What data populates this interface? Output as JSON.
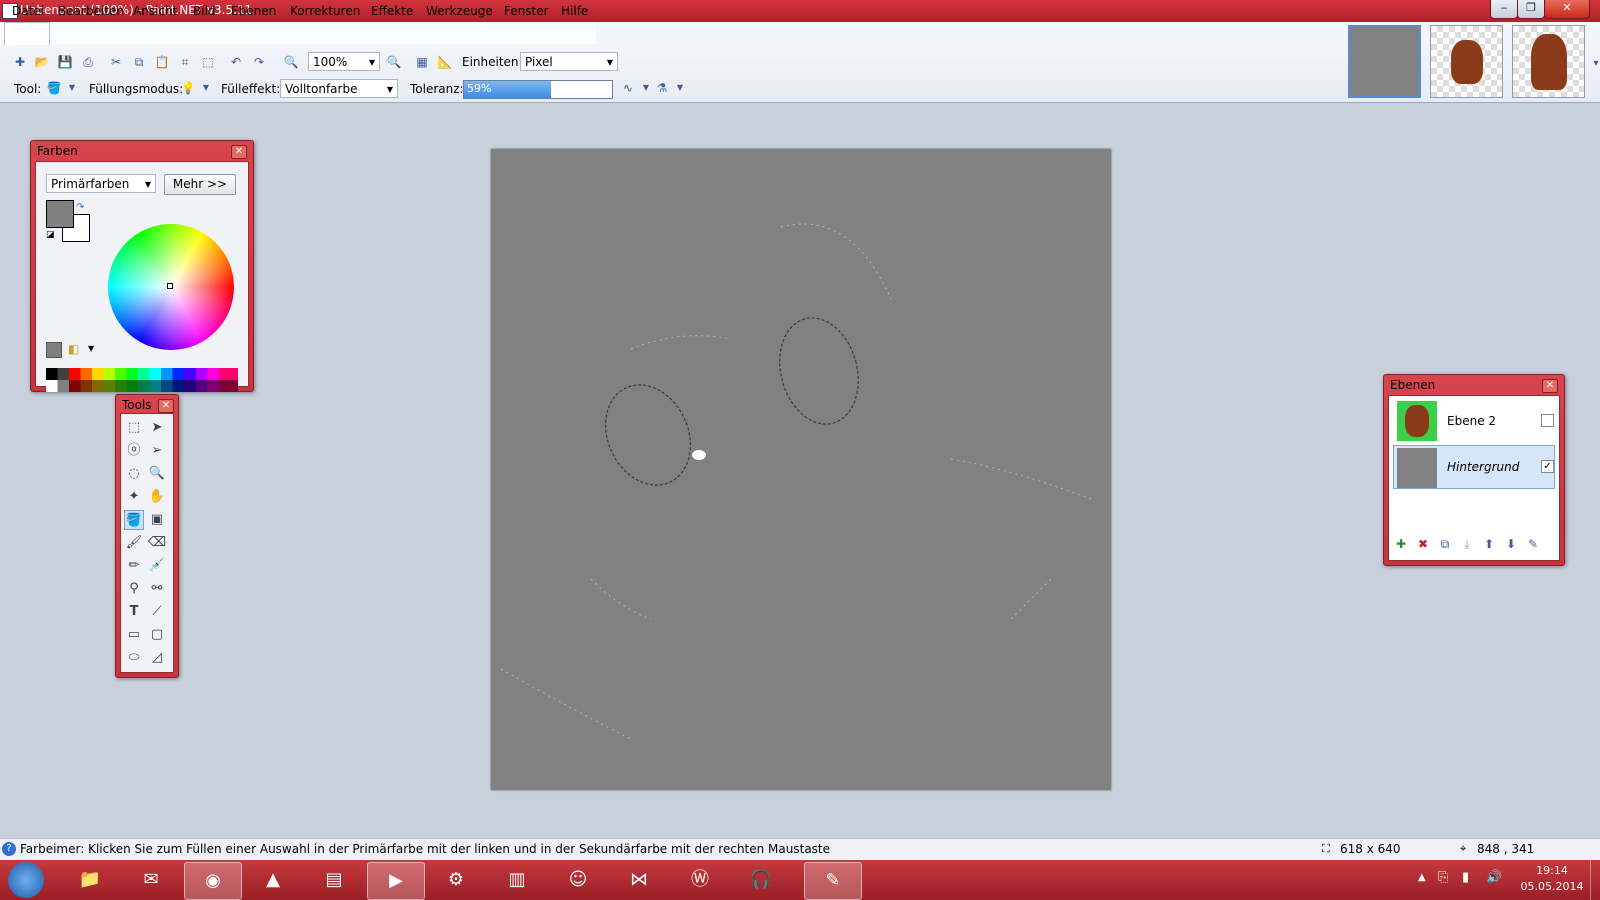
{
  "window": {
    "title": "Unbenannt (100%) - Paint.NET v3.5.11"
  },
  "menu": [
    "Datei",
    "Bearbeiten",
    "Ansicht",
    "Bild",
    "Ebenen",
    "Korrekturen",
    "Effekte",
    "Werkzeuge",
    "Fenster",
    "Hilfe"
  ],
  "toolbar": {
    "zoom": "100%",
    "units_label": "Einheiten:",
    "units_value": "Pixel",
    "tool_label": "Tool:",
    "fill_mode_label": "Füllungsmodus:",
    "fill_effect_label": "Fülleffekt:",
    "fill_effect_value": "Volltonfarbe",
    "tolerance_label": "Toleranz:",
    "tolerance_text": "59%",
    "tolerance_value": 0.59
  },
  "colors_window": {
    "title": "Farben",
    "mode": "Primärfarben",
    "more_button": "Mehr >>",
    "primary_color": "#808080",
    "secondary_color": "#ffffff"
  },
  "tools_window": {
    "title": "Tools"
  },
  "layers_window": {
    "title": "Ebenen",
    "layers": [
      {
        "name": "Ebene 2",
        "visible": false
      },
      {
        "name": "Hintergrund",
        "visible": true
      }
    ]
  },
  "status": {
    "hint": "Farbeimer: Klicken Sie zum Füllen einer Auswahl in der Primärfarbe mit der linken und in der Sekundärfarbe mit der rechten Maustaste",
    "image_size": "618 x 640",
    "cursor_pos": "848 , 341"
  },
  "taskbar": {
    "time": "19:14",
    "date": "05.05.2014"
  },
  "colors": {
    "accent": "#c62f39",
    "canvas": "#818181"
  }
}
